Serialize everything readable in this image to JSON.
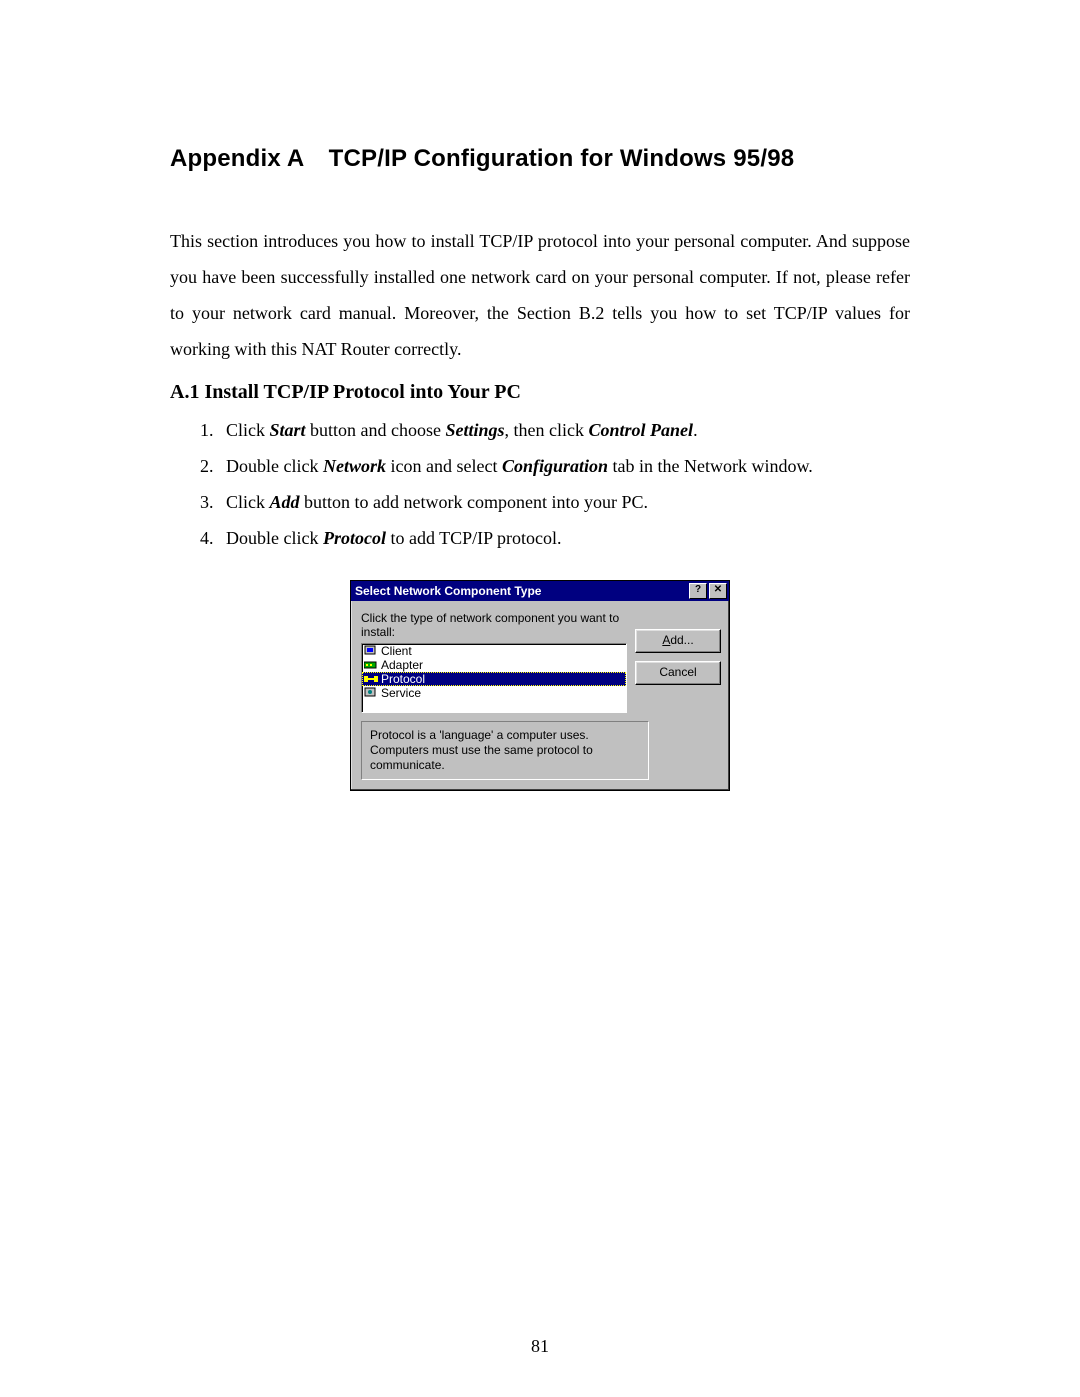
{
  "doc": {
    "heading": "Appendix A TCP/IP Configuration for Windows 95/98",
    "intro": "This section introduces you how to install TCP/IP protocol into your personal computer. And suppose you have been successfully installed one network card on your personal computer. If not, please refer to your network card manual. Moreover, the Section B.2 tells you how to set TCP/IP values for working with this NAT Router correctly.",
    "section": "A.1 Install TCP/IP Protocol into Your PC",
    "steps": [
      {
        "pre1": "Click ",
        "b1": "Start",
        "mid1": " button and choose ",
        "b2": "Settings",
        "mid2": ", then click ",
        "b3": "Control Panel",
        "post": "."
      },
      {
        "pre1": "Double click ",
        "b1": "Network",
        "mid1": " icon and select ",
        "b2": "Configuration",
        "mid2": " tab in the Network window.",
        "b3": "",
        "post": ""
      },
      {
        "pre1": "Click ",
        "b1": "Add",
        "mid1": " button to add network component into your PC.",
        "b2": "",
        "mid2": "",
        "b3": "",
        "post": ""
      },
      {
        "pre1": "Double click ",
        "b1": "Protocol",
        "mid1": " to add TCP/IP protocol.",
        "b2": "",
        "mid2": "",
        "b3": "",
        "post": ""
      }
    ],
    "page_number": "81"
  },
  "dialog": {
    "title": "Select Network Component Type",
    "prompt": "Click the type of network component you want to install:",
    "items": [
      {
        "label": "Client",
        "selected": false,
        "icon": "client-icon"
      },
      {
        "label": "Adapter",
        "selected": false,
        "icon": "adapter-icon"
      },
      {
        "label": "Protocol",
        "selected": true,
        "icon": "protocol-icon"
      },
      {
        "label": "Service",
        "selected": false,
        "icon": "service-icon"
      }
    ],
    "buttons": {
      "add_ul": "A",
      "add_rest": "dd...",
      "cancel": "Cancel"
    },
    "description": "Protocol is a 'language' a computer uses. Computers must use the same protocol to communicate."
  }
}
